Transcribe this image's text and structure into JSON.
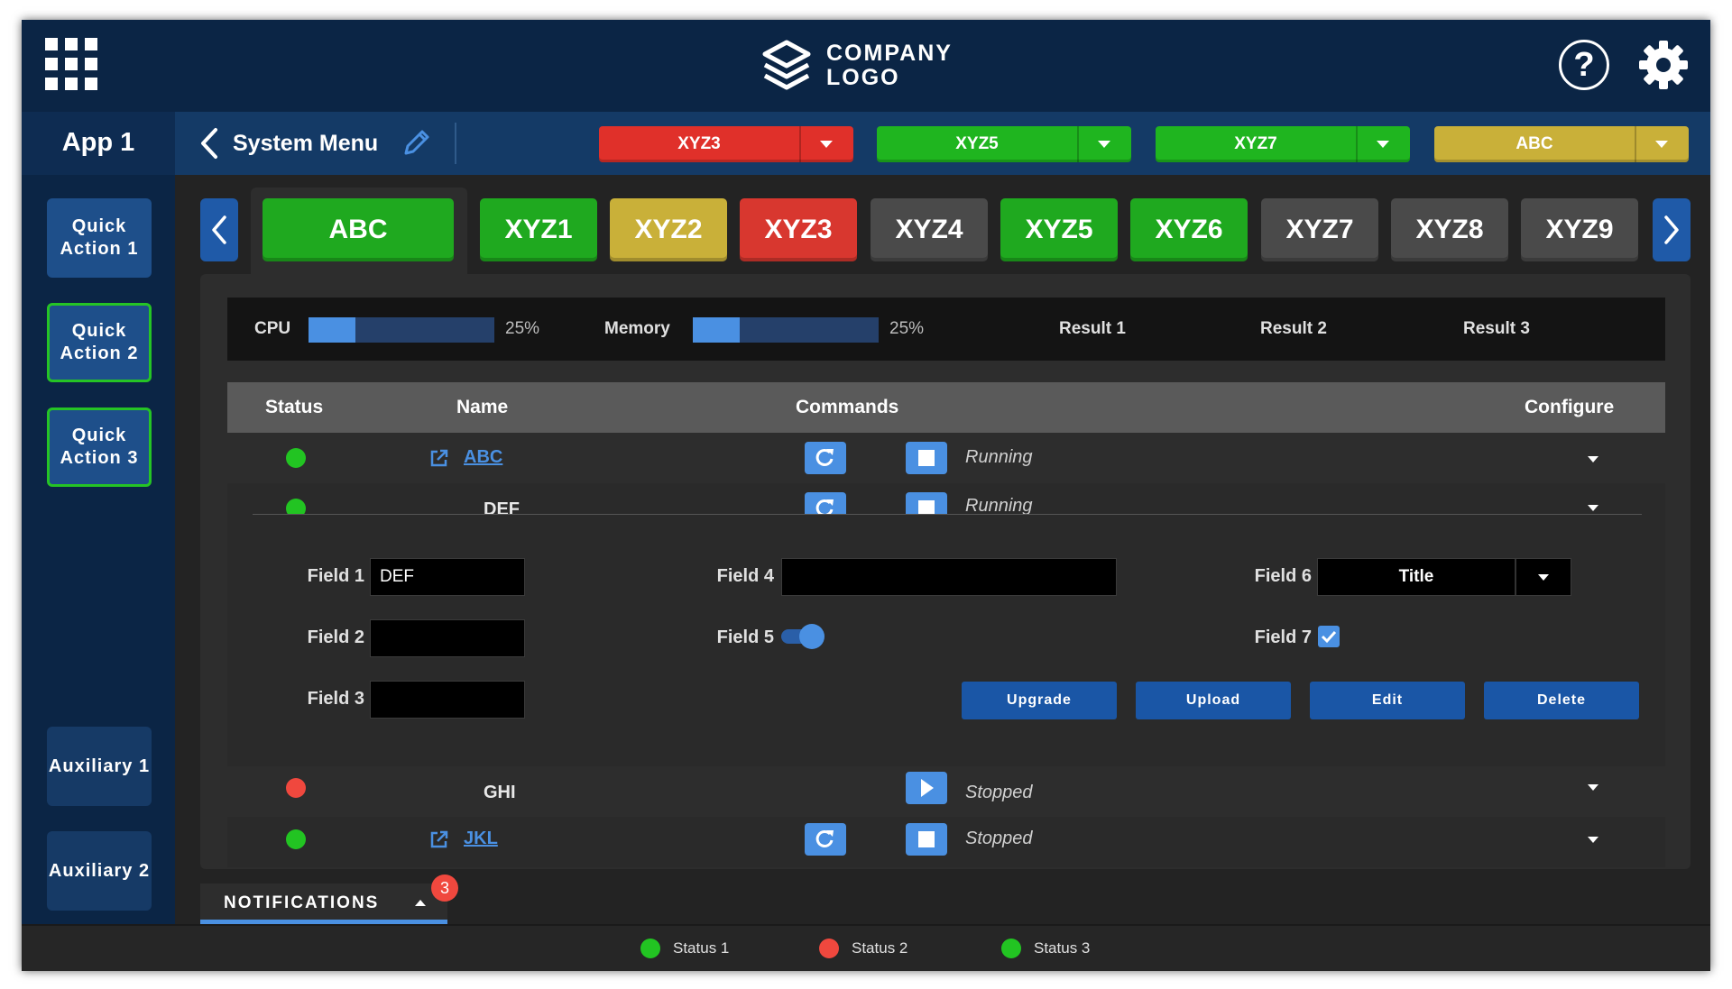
{
  "header": {
    "logo_text_line1": "COMPANY",
    "logo_text_line2": "LOGO",
    "help_glyph": "?"
  },
  "appbar": {
    "app_name": "App 1",
    "title": "System Menu",
    "dropdowns": [
      {
        "label": "XYZ3",
        "color": "#e0302a"
      },
      {
        "label": "XYZ5",
        "color": "#1fb51f"
      },
      {
        "label": "XYZ7",
        "color": "#1fb51f"
      },
      {
        "label": "ABC",
        "color": "#c9b039"
      }
    ]
  },
  "sidebar": {
    "quick_actions": [
      "Quick Action 1",
      "Quick Action 2",
      "Quick Action 3"
    ],
    "auxiliary": [
      "Auxiliary 1",
      "Auxiliary 2"
    ]
  },
  "tabs": [
    {
      "label": "ABC",
      "color": "#1fa91f"
    },
    {
      "label": "XYZ1",
      "color": "#1fa91f"
    },
    {
      "label": "XYZ2",
      "color": "#c9b039"
    },
    {
      "label": "XYZ3",
      "color": "#d8372f"
    },
    {
      "label": "XYZ4",
      "color": "#4a4a4a"
    },
    {
      "label": "XYZ5",
      "color": "#1fa91f"
    },
    {
      "label": "XYZ6",
      "color": "#1fa91f"
    },
    {
      "label": "XYZ7",
      "color": "#4a4a4a"
    },
    {
      "label": "XYZ8",
      "color": "#4a4a4a"
    },
    {
      "label": "XYZ9",
      "color": "#4a4a4a"
    }
  ],
  "metrics": {
    "cpu_label": "CPU",
    "cpu_pct": "25%",
    "cpu_value": 0.25,
    "memory_label": "Memory",
    "memory_pct": "25%",
    "memory_value": 0.25,
    "results": [
      "Result 1",
      "Result 2",
      "Result 3"
    ]
  },
  "table": {
    "headers": {
      "status": "Status",
      "name": "Name",
      "commands": "Commands",
      "configure": "Configure"
    },
    "rows": [
      {
        "status": "green",
        "name": "ABC",
        "linked": true,
        "state": "Running"
      },
      {
        "status": "green",
        "name": "DEF",
        "linked": false,
        "state": "Running"
      },
      {
        "status": "red",
        "name": "GHI",
        "linked": false,
        "state": "Stopped"
      },
      {
        "status": "green",
        "name": "JKL",
        "linked": true,
        "state": "Stopped"
      }
    ]
  },
  "detail": {
    "field1_label": "Field 1",
    "field1_value": "DEF",
    "field2_label": "Field 2",
    "field3_label": "Field 3",
    "field4_label": "Field 4",
    "field5_label": "Field 5",
    "field5_on": true,
    "field6_label": "Field 6",
    "field6_value": "Title",
    "field7_label": "Field 7",
    "field7_checked": true,
    "buttons": [
      "Upgrade",
      "Upload",
      "Edit",
      "Delete"
    ]
  },
  "notifications": {
    "label": "NOTIFICATIONS",
    "count": "3"
  },
  "statusbar": [
    {
      "label": "Status 1",
      "color": "green"
    },
    {
      "label": "Status 2",
      "color": "red"
    },
    {
      "label": "Status 3",
      "color": "green"
    }
  ],
  "colors": {
    "accent": "#4a90e2",
    "header_bg": "#0b2545",
    "green": "#22c422",
    "red": "#f0483e"
  }
}
